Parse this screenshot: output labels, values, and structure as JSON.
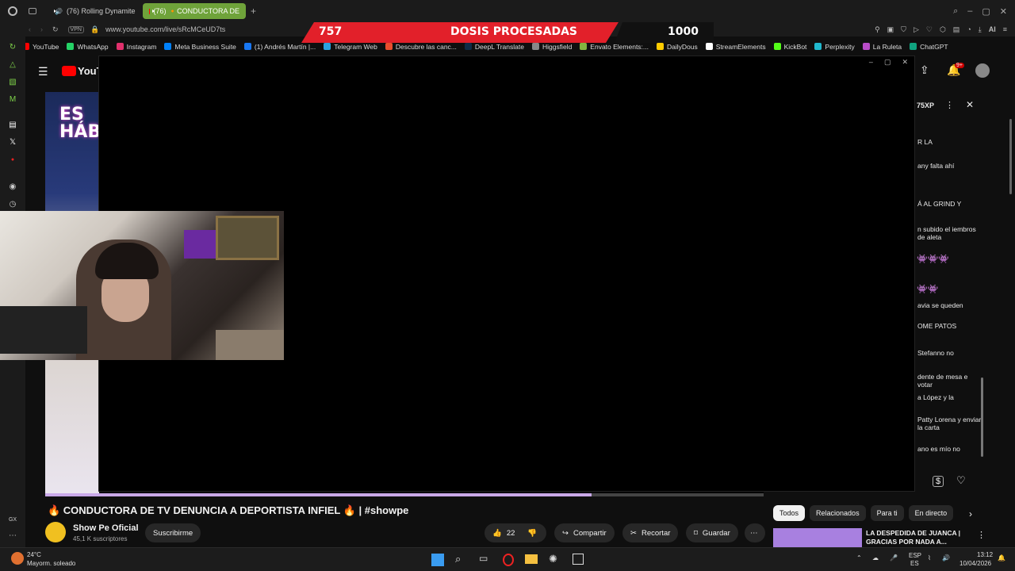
{
  "browser": {
    "tabs": [
      {
        "label": "(76) Rolling Dynamite"
      },
      {
        "label": "(76) 🔸CONDUCTORA DE"
      }
    ],
    "vpn": "VPN",
    "url": "www.youtube.com/live/sRcMCeUD7ts",
    "ai_label": "AI",
    "bookmarks": [
      "YouTube",
      "WhatsApp",
      "Instagram",
      "Meta Business Suite",
      "(1) Andrés Martín |...",
      "Telegram Web",
      "Descubre las canc...",
      "DeepL Translate",
      "Higgsfield",
      "Envato Elements:...",
      "DailyDous",
      "StreamElements",
      "KickBot",
      "Perplexity",
      "La Ruleta",
      "ChatGPT"
    ],
    "bookmark_colors": [
      "#ff0000",
      "#25d366",
      "#e1306c",
      "#0081fb",
      "#1877f2",
      "#2aa3df",
      "#e94e2e",
      "#0f2b46",
      "#888888",
      "#82b440",
      "#ffcc00",
      "#ffffff",
      "#53fc18",
      "#20b8cd",
      "#b84cc8",
      "#10a37f"
    ]
  },
  "overlay": {
    "left_number": "757",
    "label": "DOSIS PROCESADAS",
    "right_number": "1000"
  },
  "youtube": {
    "logo_text": "YouTu",
    "notif_count": "9+",
    "thumb_text": "ES HÁB",
    "xp_badge": "75XP",
    "video_title": "🔥 CONDUCTORA DE TV DENUNCIA A DEPORTISTA INFIEL 🔥 | #showpe",
    "channel_name": "Show Pe Oficial",
    "subscribers": "45,1 K suscriptores",
    "subscribe_label": "Suscribirme",
    "like_count": "22",
    "share_label": "Compartir",
    "clip_label": "Recortar",
    "save_label": "Guardar",
    "chips": [
      "Todos",
      "Relacionados",
      "Para ti",
      "En directo"
    ],
    "rec_title": "LA DESPEDIDA DE JUANCA | GRACIAS POR NADA A..."
  },
  "chat_lines": [
    "R LA",
    "any falta ahí",
    "Á AL GRIND Y",
    "n subido el iembros de aleta",
    "avia se queden",
    "OME PATOS",
    "Stefanno no",
    "dente de mesa e votar",
    "a López y la",
    "Patty Lorena y enviar la carta",
    "ano es mío no"
  ],
  "taskbar": {
    "temperature": "24°C",
    "weather": "Mayorm. soleado",
    "lang_top": "ESP",
    "lang_bottom": "ES",
    "time": "13:12",
    "date": "10/04/2026"
  }
}
